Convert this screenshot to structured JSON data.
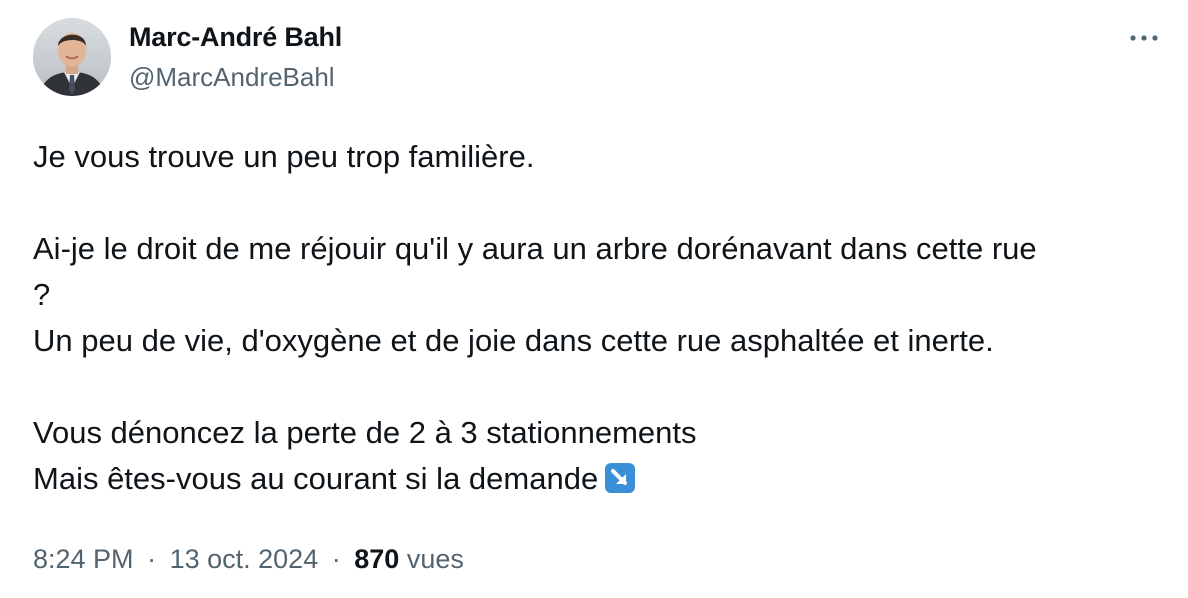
{
  "author": {
    "name": "Marc-André Bahl",
    "handle": "@MarcAndreBahl"
  },
  "tweet": {
    "lines": [
      "Je vous trouve un peu trop familière.",
      "",
      "Ai-je le droit de me réjouir qu'il y aura un arbre dorénavant dans cette rue",
      "?",
      "Un peu de vie, d'oxygène et de joie dans cette rue asphaltée et inerte.",
      "",
      "Vous dénoncez la perte de 2 à 3 stationnements",
      "Mais êtes-vous au courant si la demande"
    ],
    "trailing_emoji": "arrow-down-right-icon"
  },
  "meta": {
    "time": "8:24 PM",
    "date": "13 oct. 2024",
    "separator": "·",
    "view_count": "870",
    "view_label": "vues"
  },
  "colors": {
    "text_primary": "#0f1419",
    "text_secondary": "#536471",
    "emoji_blue": "#3b8fd6"
  }
}
